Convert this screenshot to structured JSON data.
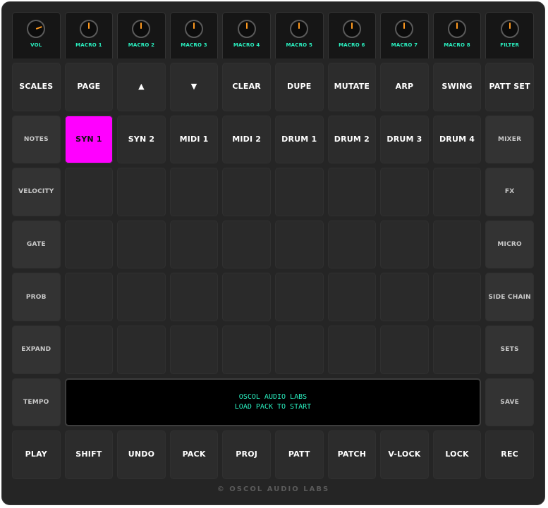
{
  "knobs": [
    {
      "label": "VOL",
      "angle": 70
    },
    {
      "label": "MACRO 1",
      "angle": 0
    },
    {
      "label": "MACRO 2",
      "angle": 0
    },
    {
      "label": "MACRO 3",
      "angle": 0
    },
    {
      "label": "MACRO 4",
      "angle": 0
    },
    {
      "label": "MACRO 5",
      "angle": 0
    },
    {
      "label": "MACRO 6",
      "angle": 0
    },
    {
      "label": "MACRO 7",
      "angle": 0
    },
    {
      "label": "MACRO 8",
      "angle": 0
    },
    {
      "label": "FILTER",
      "angle": 0
    }
  ],
  "top_row": [
    "SCALES",
    "PAGE",
    "▲",
    "▼",
    "CLEAR",
    "DUPE",
    "MUTATE",
    "ARP",
    "SWING",
    "PATT SET"
  ],
  "left_column": [
    "NOTES",
    "VELOCITY",
    "GATE",
    "PROB",
    "EXPAND",
    "TEMPO"
  ],
  "right_column": [
    "MIXER",
    "FX",
    "MICRO",
    "SIDE CHAIN",
    "SETS",
    "SAVE"
  ],
  "tracks": [
    "SYN 1",
    "SYN 2",
    "MIDI 1",
    "MIDI 2",
    "DRUM 1",
    "DRUM 2",
    "DRUM 3",
    "DRUM 4"
  ],
  "active_track": "SYN 1",
  "display": {
    "line1": "OSCOL AUDIO LABS",
    "line2": "LOAD PACK TO START"
  },
  "bottom_row": [
    "PLAY",
    "SHIFT",
    "UNDO",
    "PACK",
    "PROJ",
    "PATT",
    "PATCH",
    "V-LOCK",
    "LOCK",
    "REC"
  ],
  "footer": "© OSCOL AUDIO LABS",
  "colors": {
    "accent": "#ff00ff",
    "knob_indicator": "#ff9a1f",
    "label_teal": "#2af0c0"
  }
}
